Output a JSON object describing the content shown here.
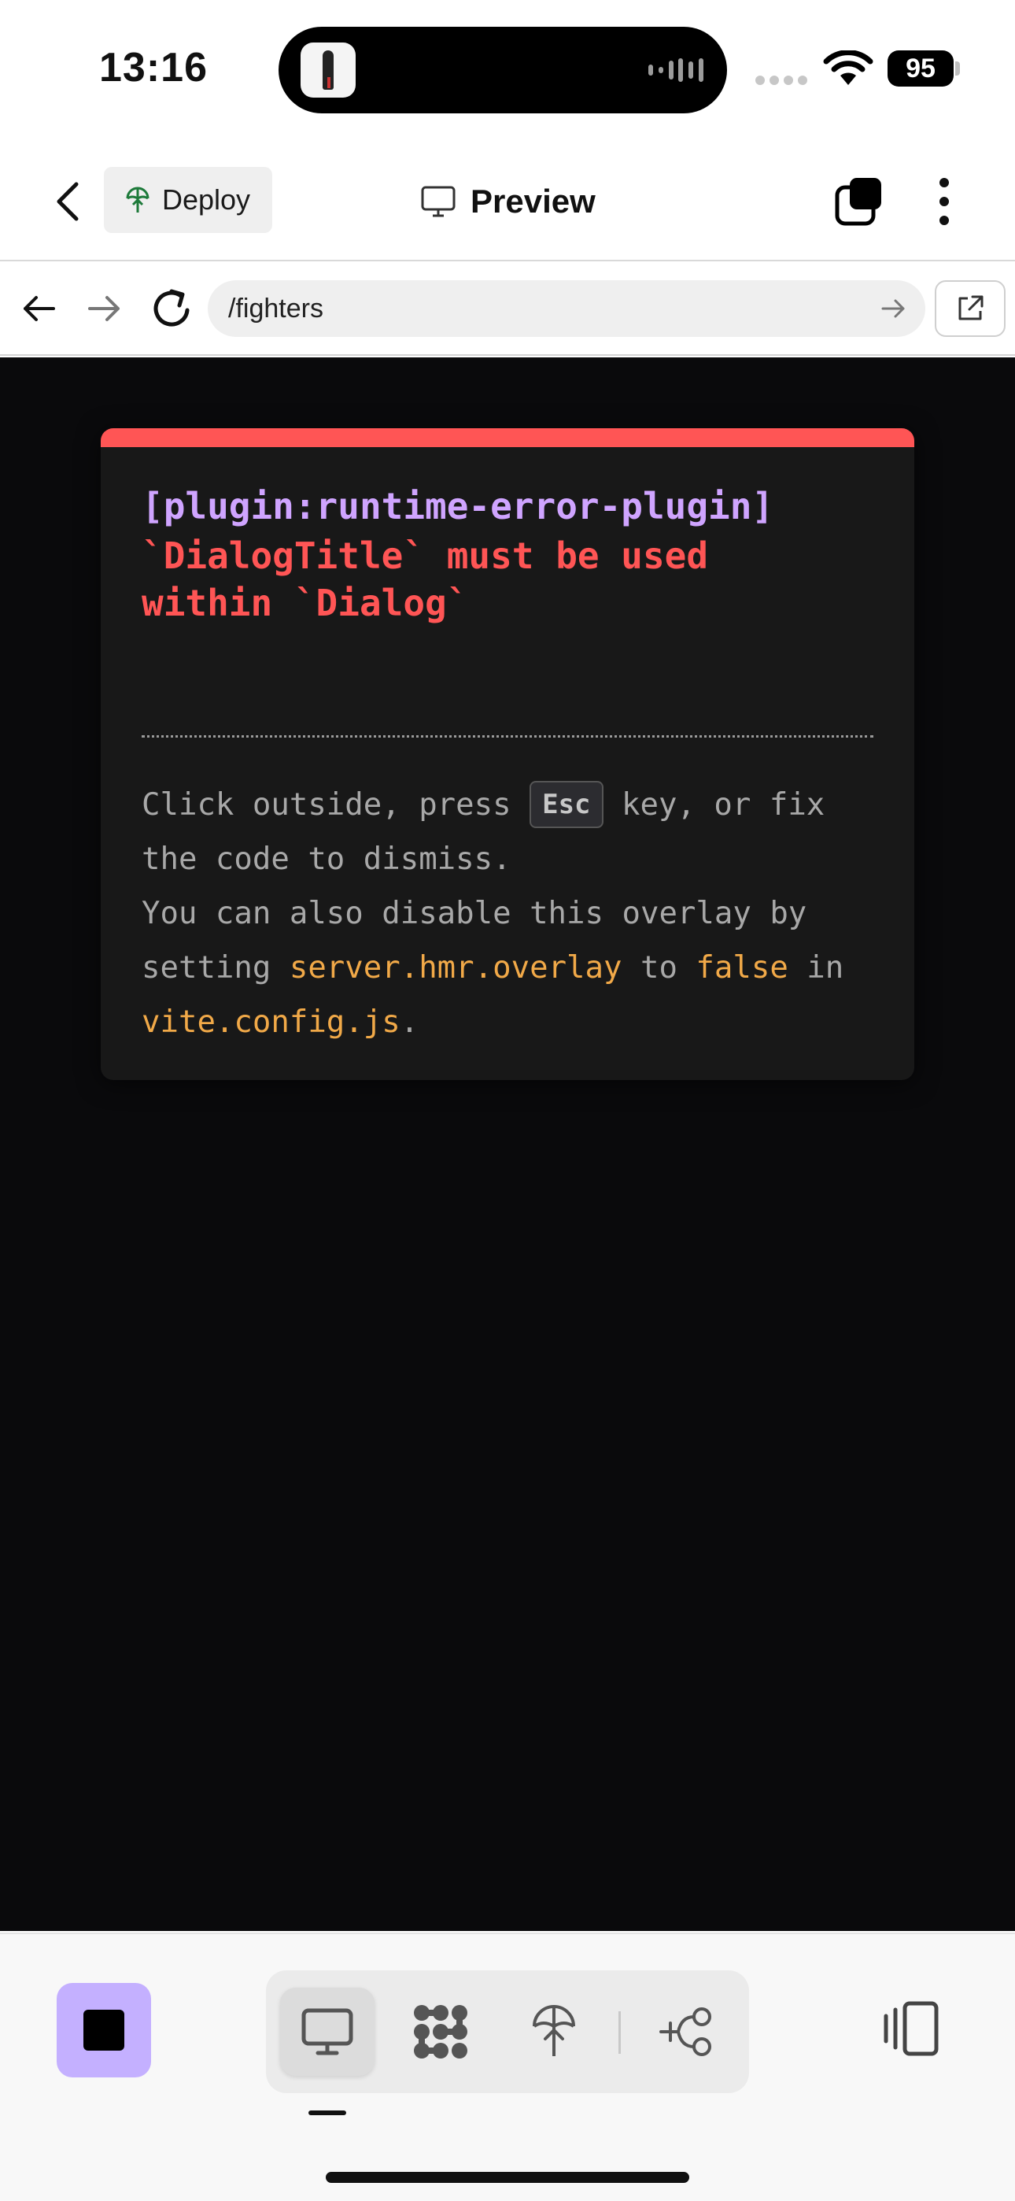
{
  "status_bar": {
    "time": "13:16",
    "battery": "95"
  },
  "header": {
    "deploy_label": "Deploy",
    "title": "Preview"
  },
  "browser": {
    "url": "/fighters"
  },
  "error_overlay": {
    "plugin": "[plugin:runtime-error-plugin]",
    "message": "`DialogTitle` must be used\nwithin `Dialog`",
    "help_1": "Click outside, press ",
    "key": "Esc",
    "help_2": " key, or fix the code to dismiss.",
    "help_3": "You can also disable this overlay by setting ",
    "code_1": "server.hmr.overlay",
    "help_4": " to ",
    "code_2": "false",
    "help_5": " in ",
    "code_3": "vite.config.js",
    "help_6": ".",
    "colors": {
      "accent_bar": "#ff5555",
      "plugin": "#cfa4ff",
      "message": "#ff5555",
      "code": "#f1a948"
    }
  },
  "toolbar": {
    "items": [
      "stop-icon",
      "monitor-icon",
      "components-icon",
      "deploy-icon",
      "flow-icon",
      "panel-toggle-icon"
    ],
    "stop_color": "#c4b0ff"
  }
}
